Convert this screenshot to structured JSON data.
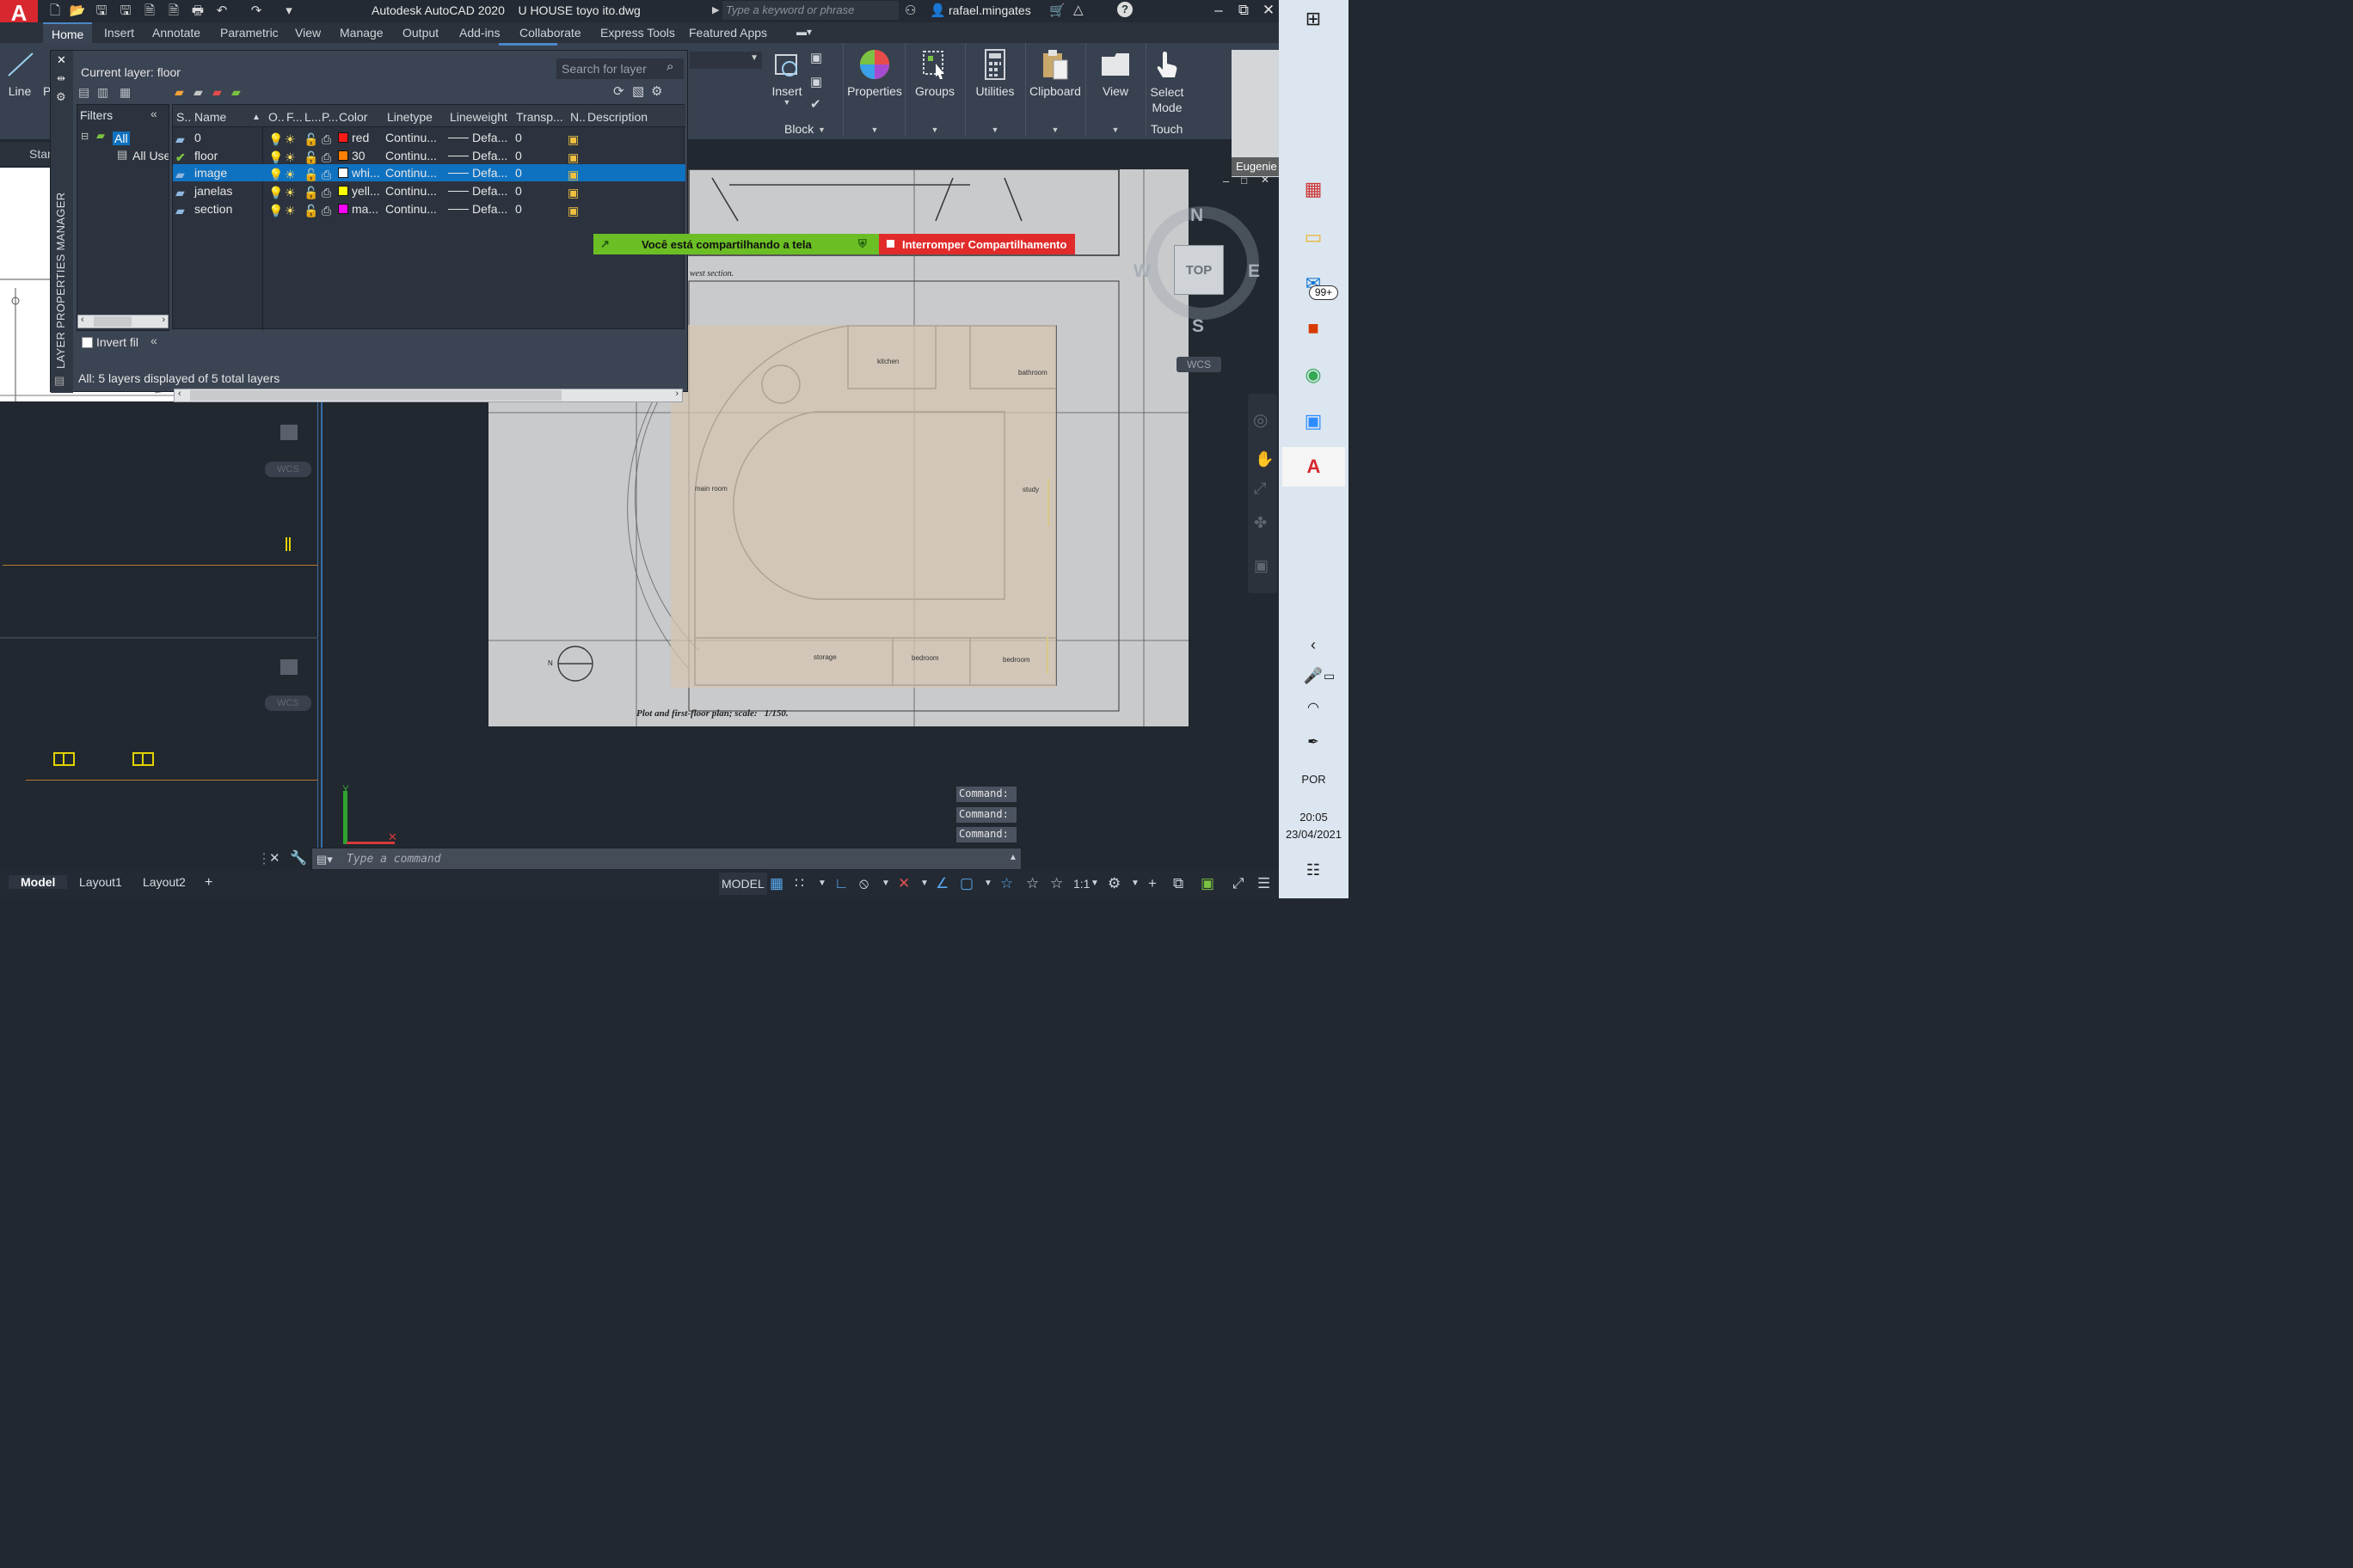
{
  "app": {
    "title": "Autodesk AutoCAD 2020    U HOUSE toyo ito.dwg",
    "search_placeholder": "Type a keyword or phrase",
    "user": "rafael.mingates"
  },
  "ribbon_tabs": [
    "Home",
    "Insert",
    "Annotate",
    "Parametric",
    "View",
    "Manage",
    "Output",
    "Add-ins",
    "Collaborate",
    "Express Tools",
    "Featured Apps"
  ],
  "ribbon": {
    "line_label": "Line",
    "insert_label": "Insert",
    "block_label": "Block",
    "properties_label": "Properties",
    "groups_label": "Groups",
    "utilities_label": "Utilities",
    "clipboard_label": "Clipboard",
    "view_label": "View",
    "select_mode_label": "Select\nMode",
    "touch_label": "Touch"
  },
  "start_tab": "Star",
  "layer_manager": {
    "vertical_title": "LAYER PROPERTIES MANAGER",
    "current_layer": "Current layer: floor",
    "search_placeholder": "Search for layer",
    "filters_header": "Filters",
    "filter_tree": [
      "All",
      "All Use"
    ],
    "invert_filter": "Invert fil",
    "status": "All: 5 layers displayed of 5 total layers",
    "columns": [
      "S..",
      "Name",
      "O..",
      "F...",
      "L...",
      "P...",
      "Color",
      "Linetype",
      "Lineweight",
      "Transp...",
      "N..",
      "Description"
    ],
    "layers": [
      {
        "name": "0",
        "color_name": "red",
        "swatch": "#ff1a1a",
        "linetype": "Continu...",
        "lineweight": "Defa...",
        "transparency": "0",
        "current": false,
        "selected": false
      },
      {
        "name": "floor",
        "color_name": "30",
        "swatch": "#ff7f00",
        "linetype": "Continu...",
        "lineweight": "Defa...",
        "transparency": "0",
        "current": true,
        "selected": false
      },
      {
        "name": "image",
        "color_name": "whi...",
        "swatch": "#ffffff",
        "linetype": "Continu...",
        "lineweight": "Defa...",
        "transparency": "0",
        "current": false,
        "selected": true
      },
      {
        "name": "janelas",
        "color_name": "yell...",
        "swatch": "#ffff00",
        "linetype": "Continu...",
        "lineweight": "Defa...",
        "transparency": "0",
        "current": false,
        "selected": false
      },
      {
        "name": "section",
        "color_name": "ma...",
        "swatch": "#ff00ff",
        "linetype": "Continu...",
        "lineweight": "Defa...",
        "transparency": "0",
        "current": false,
        "selected": false
      }
    ]
  },
  "drawing": {
    "section_caption": "west section.",
    "plan_caption": "Plot and first-floor plan; scale:   1/150.",
    "rooms": [
      "kitchen",
      "bathroom",
      "main room",
      "study",
      "storage",
      "bedroom",
      "bedroom"
    ]
  },
  "share_banner": {
    "sharing_text": "Você está compartilhando a tela",
    "stop_text": "Interromper Compartilhamento"
  },
  "viewcube": {
    "top": "TOP",
    "n": "N",
    "s": "S",
    "e": "E",
    "w": "W",
    "wcs": "WCS"
  },
  "left_viewport_wcs": "WCS",
  "command": {
    "history": [
      "Command:",
      "Command:",
      "Command:"
    ],
    "placeholder": "Type a command"
  },
  "status": {
    "layout_tabs": [
      "Model",
      "Layout1",
      "Layout2"
    ],
    "model_label": "MODEL",
    "scale": "1:1"
  },
  "webcam": {
    "name": "Eugenie Gomes"
  },
  "taskbar": {
    "mail_badge": "99+",
    "language": "POR",
    "time": "20:05",
    "date": "23/04/2021"
  },
  "colors": {
    "accent": "#0f72c1",
    "share_green": "#6bbe24",
    "share_red": "#e12b2b",
    "autocad_red": "#d8272f"
  }
}
